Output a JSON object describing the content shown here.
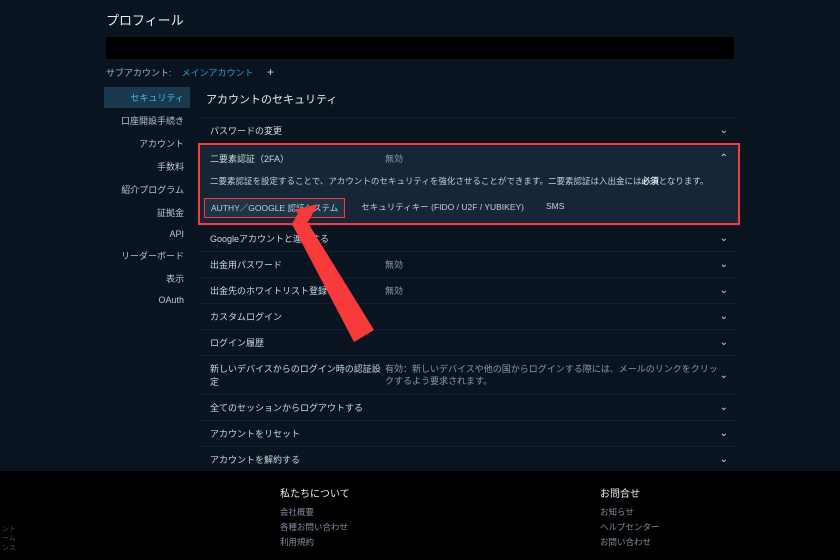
{
  "page_title": "プロフィール",
  "subaccount": {
    "label": "サブアカウント:",
    "link": "メインアカウント",
    "plus": "+"
  },
  "sidebar": {
    "items": [
      {
        "label": "セキュリティ",
        "active": true
      },
      {
        "label": "口座開設手続き"
      },
      {
        "label": "アカウント"
      },
      {
        "label": "手数料"
      },
      {
        "label": "紹介プログラム"
      },
      {
        "label": "証拠金"
      },
      {
        "label": "API"
      },
      {
        "label": "リーダーボード"
      },
      {
        "label": "表示"
      },
      {
        "label": "OAuth"
      }
    ]
  },
  "section_title": "アカウントのセキュリティ",
  "rows": {
    "pwd": {
      "label": "パスワードの変更",
      "value": ""
    },
    "twofa": {
      "label": "二要素認証（2FA）",
      "value": "無効",
      "desc_a": "二要素認証を設定することで、アカウントのセキュリティを強化させることができます。二要素認証は入出金には",
      "desc_b": "必須",
      "desc_c": "となります。",
      "tabs": [
        "AUTHY／GOOGLE 認証システム",
        "セキュリティキー (FIDO / U2F / YUBIKEY)",
        "SMS"
      ]
    },
    "google": {
      "label": "Googleアカウントと連携する",
      "value": ""
    },
    "wdpass": {
      "label": "出金用パスワード",
      "value": "無効"
    },
    "whitelist": {
      "label": "出金先のホワイトリスト登録",
      "value": "無効"
    },
    "custlogin": {
      "label": "カスタムログイン",
      "value": ""
    },
    "history": {
      "label": "ログイン履歴",
      "value": ""
    },
    "newdev": {
      "label": "新しいデバイスからのログイン時の認証設定",
      "value": "有効：新しいデバイスや他の国からログインする際には、メールのリンクをクリックするよう要求されます。"
    },
    "logoutall": {
      "label": "全てのセッションからログアウトする",
      "value": ""
    },
    "reset": {
      "label": "アカウントをリセット",
      "value": ""
    },
    "cancel": {
      "label": "アカウントを解約する",
      "value": ""
    }
  },
  "footer": {
    "left": [
      "ント",
      "ーム",
      "ンス"
    ],
    "about": {
      "h": "私たちについて",
      "links": [
        "会社概要",
        "各種お問い合わせ",
        "利用規約"
      ]
    },
    "contact": {
      "h": "お問合せ",
      "links": [
        "お知らせ",
        "ヘルプセンター",
        "お問い合わせ"
      ]
    }
  },
  "colors": {
    "highlight": "#f83a3a",
    "accent": "#1fa3d4"
  }
}
